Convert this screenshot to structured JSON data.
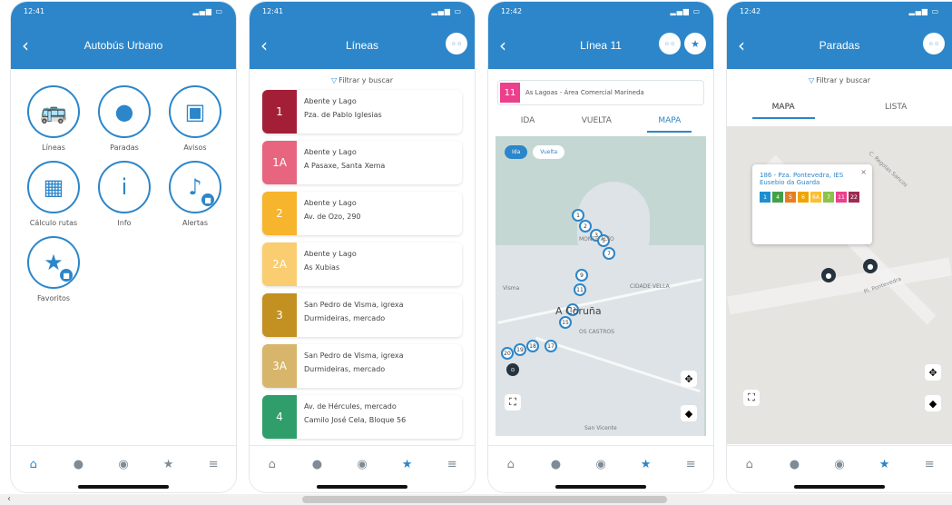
{
  "screens": [
    {
      "time": "12:41",
      "title": "Autobús Urbano",
      "menu": [
        {
          "label": "Líneas",
          "icon": "bus-icon"
        },
        {
          "label": "Paradas",
          "icon": "pin-icon"
        },
        {
          "label": "Avisos",
          "icon": "message-icon"
        },
        {
          "label": "Cálculo rutas",
          "icon": "map-route-icon"
        },
        {
          "label": "Info",
          "icon": "info-icon"
        },
        {
          "label": "Alertas",
          "icon": "bell-icon"
        },
        {
          "label": "Favoritos",
          "icon": "star-icon"
        }
      ]
    },
    {
      "time": "12:41",
      "title": "Líneas",
      "filter": "Filtrar y buscar",
      "lines": [
        {
          "code": "1",
          "color": "#a31f37",
          "origin": "Abente y Lago",
          "destination": "Pza. de Pablo Iglesias"
        },
        {
          "code": "1A",
          "color": "#e7657e",
          "origin": "Abente y Lago",
          "destination": "A Pasaxe, Santa Xema"
        },
        {
          "code": "2",
          "color": "#f7b42d",
          "origin": "Abente y Lago",
          "destination": "Av. de Ozo, 290"
        },
        {
          "code": "2A",
          "color": "#f9cd70",
          "origin": "Abente y Lago",
          "destination": "As Xubias"
        },
        {
          "code": "3",
          "color": "#c39022",
          "origin": "San Pedro de Visma, igrexa",
          "destination": "Durmideiras, mercado"
        },
        {
          "code": "3A",
          "color": "#d7b56a",
          "origin": "San Pedro de Visma, igrexa",
          "destination": "Durmideiras, mercado"
        },
        {
          "code": "4",
          "color": "#2f9e6b",
          "origin": "Av. de Hércules, mercado",
          "destination": "Camilo José Cela, Bloque 56"
        }
      ]
    },
    {
      "time": "12:42",
      "title": "Línea 11",
      "route_code": "11",
      "route_name": "As Lagoas - Área Comercial Marineda",
      "tabs": [
        "IDA",
        "VUELTA",
        "MAPA"
      ],
      "active_tab": "MAPA",
      "toggle": [
        "Ida",
        "Vuelta"
      ],
      "labels": [
        "Visma",
        "CIDADE VELLA",
        "MONTE ALTO",
        "OS CASTROS",
        "San Vicente"
      ],
      "city": "A Coruña"
    },
    {
      "time": "12:42",
      "title": "Paradas",
      "filter": "Filtrar y buscar",
      "tabs": [
        "MAPA",
        "LISTA"
      ],
      "popup_title": "186 - Pza. Pontevedra, IES Eusebio da Guarda",
      "chips": [
        {
          "code": "1",
          "color": "#1f8ed1"
        },
        {
          "code": "4",
          "color": "#43a047"
        },
        {
          "code": "5",
          "color": "#e67e22"
        },
        {
          "code": "6",
          "color": "#f0a500"
        },
        {
          "code": "6A",
          "color": "#fbc02d"
        },
        {
          "code": "7",
          "color": "#8bc34a"
        },
        {
          "code": "11",
          "color": "#ec3f8c"
        },
        {
          "code": "22",
          "color": "#9c2b52"
        }
      ],
      "street_1": "Pl. Pontevedra",
      "street_2": "C. Regolas Sancos"
    }
  ],
  "tabbar": [
    "home-icon",
    "person-icon",
    "compass-icon",
    "favorites-bus-icon",
    "menu-icon"
  ]
}
